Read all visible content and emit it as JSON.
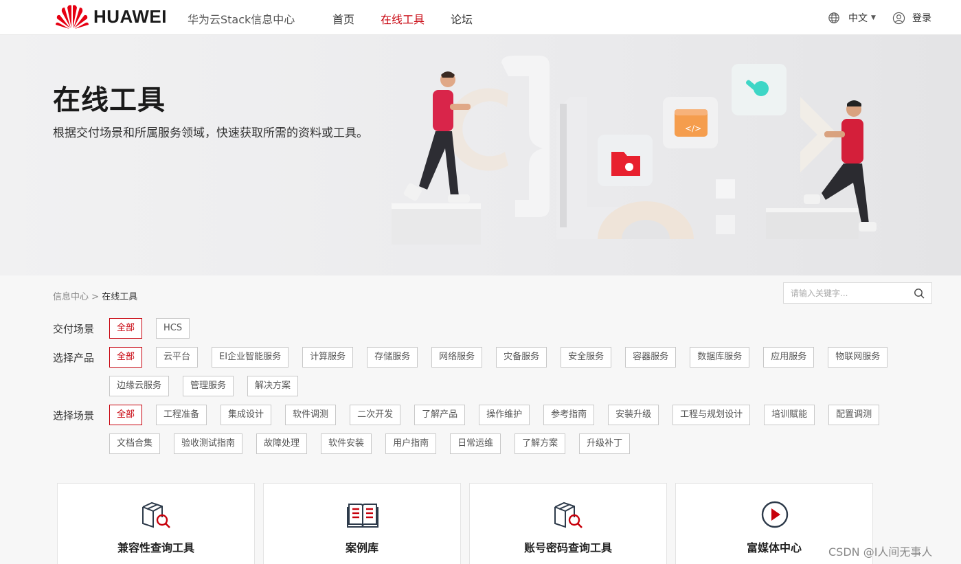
{
  "header": {
    "logo_text": "HUAWEI",
    "site_name": "华为云Stack信息中心",
    "nav": [
      {
        "label": "首页",
        "active": false
      },
      {
        "label": "在线工具",
        "active": true
      },
      {
        "label": "论坛",
        "active": false
      }
    ],
    "language": "中文",
    "login": "登录"
  },
  "banner": {
    "title": "在线工具",
    "subtitle": "根据交付场景和所属服务领域，快速获取所需的资料或工具。"
  },
  "breadcrumb": {
    "parent": "信息中心",
    "separator": ">",
    "current": "在线工具"
  },
  "search": {
    "placeholder": "请输入关键字..."
  },
  "filters": [
    {
      "label": "交付场景",
      "tags": [
        "全部",
        "HCS"
      ]
    },
    {
      "label": "选择产品",
      "tags": [
        "全部",
        "云平台",
        "EI企业智能服务",
        "计算服务",
        "存储服务",
        "网络服务",
        "灾备服务",
        "安全服务",
        "容器服务",
        "数据库服务",
        "应用服务",
        "物联网服务",
        "边缘云服务",
        "管理服务",
        "解决方案"
      ]
    },
    {
      "label": "选择场景",
      "tags": [
        "全部",
        "工程准备",
        "集成设计",
        "软件调测",
        "二次开发",
        "了解产品",
        "操作维护",
        "参考指南",
        "安装升级",
        "工程与规划设计",
        "培训赋能",
        "配置调测",
        "文档合集",
        "验收测试指南",
        "故障处理",
        "软件安装",
        "用户指南",
        "日常运维",
        "了解方案",
        "升级补丁"
      ]
    }
  ],
  "cards": [
    {
      "title": "兼容性查询工具",
      "icon": "box-search-icon"
    },
    {
      "title": "案例库",
      "icon": "open-book-icon"
    },
    {
      "title": "账号密码查询工具",
      "icon": "box-search-icon"
    },
    {
      "title": "富媒体中心",
      "icon": "play-circle-icon"
    }
  ],
  "watermark": "CSDN @I人间无事人",
  "colors": {
    "accent": "#c7000b",
    "text": "#333333",
    "background": "#f7f7f7"
  }
}
